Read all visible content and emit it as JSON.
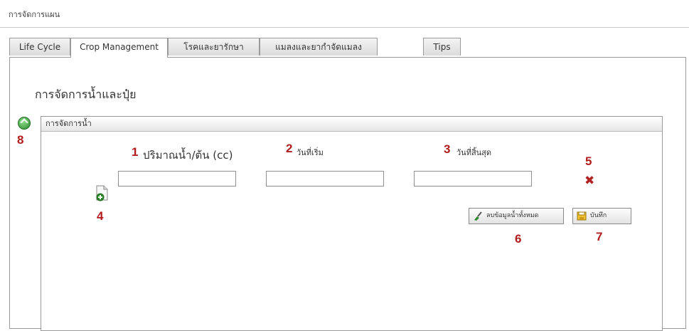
{
  "window": {
    "title": "การจัดการแผน"
  },
  "tabs": [
    {
      "label": "Life Cycle",
      "active": false
    },
    {
      "label": "Crop Management",
      "active": true
    },
    {
      "label": "โรคและยารักษา",
      "active": false
    },
    {
      "label": "แมลงและยากำจัดแมลง",
      "active": false
    },
    {
      "label": "Tips",
      "active": false
    }
  ],
  "section": {
    "title": "การจัดการน้ำและปุ๋ย"
  },
  "water": {
    "header": "การจัดการน้ำ",
    "fields": [
      {
        "label": "ปริมาณน้ำ/ต้น (cc)",
        "value": "",
        "placeholder": ""
      },
      {
        "label": "วันที่เริ่ม",
        "value": "",
        "placeholder": ""
      },
      {
        "label": "วันที่สิ้นสุด",
        "value": "",
        "placeholder": ""
      }
    ],
    "buttons": {
      "clear_all": "ลบข้อมูลน้ำทั้งหมด",
      "save": "บันทึก"
    }
  },
  "markers": [
    "1",
    "2",
    "3",
    "4",
    "5",
    "6",
    "7",
    "8"
  ],
  "icons": {
    "collapse": "collapse-up-icon",
    "add": "add-document-icon",
    "delete": "delete-x-icon",
    "clear": "clear-brush-icon",
    "save": "floppy-save-icon"
  },
  "colors": {
    "marker": "#b11c1c",
    "icon_green": "#2c8a2c",
    "delete_red": "#b22222",
    "save_yellow": "#f1c232"
  }
}
